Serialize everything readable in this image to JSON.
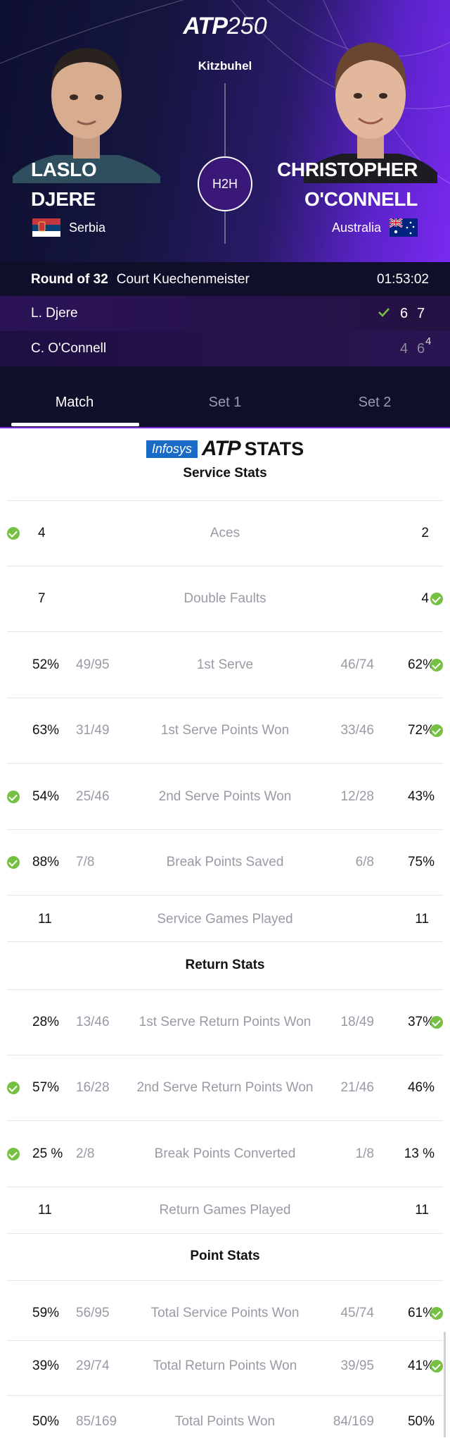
{
  "header": {
    "logo_main": "ATP",
    "logo_num": "250",
    "city": "Kitzbuhel",
    "h2h_label": "H2H",
    "player1": {
      "first": "LASLO",
      "last": "DJERE",
      "country": "Serbia"
    },
    "player2": {
      "first": "CHRISTOPHER",
      "last": "O'CONNELL",
      "country": "Australia"
    }
  },
  "match": {
    "round": "Round of 32",
    "court": "Court Kuechenmeister",
    "duration": "01:53:02",
    "p1_short": "L. Djere",
    "p2_short": "C. O'Connell",
    "p1_set1": "6",
    "p1_set2": "7",
    "p2_set1": "4",
    "p2_set2": "6",
    "p2_tb": "4"
  },
  "tabs": [
    "Match",
    "Set 1",
    "Set 2"
  ],
  "stats_brand": {
    "infosys": "Infosys",
    "atp": "ATP",
    "stats": "STATS"
  },
  "sections": {
    "service": "Service Stats",
    "return": "Return Stats",
    "point": "Point Stats"
  },
  "service_stats": [
    {
      "label": "Aces",
      "left": "4",
      "right": "2",
      "winner": "left"
    },
    {
      "label": "Double Faults",
      "left": "7",
      "right": "4",
      "winner": "right"
    },
    {
      "label": "1st Serve",
      "left": "52%",
      "left_raw": "49/95",
      "right": "62%",
      "right_raw": "46/74",
      "winner": "right"
    },
    {
      "label": "1st Serve Points Won",
      "left": "63%",
      "left_raw": "31/49",
      "right": "72%",
      "right_raw": "33/46",
      "winner": "right"
    },
    {
      "label": "2nd Serve Points Won",
      "left": "54%",
      "left_raw": "25/46",
      "right": "43%",
      "right_raw": "12/28",
      "winner": "left"
    },
    {
      "label": "Break Points Saved",
      "left": "88%",
      "left_raw": "7/8",
      "right": "75%",
      "right_raw": "6/8",
      "winner": "left"
    },
    {
      "label": "Service Games Played",
      "left": "11",
      "right": "11",
      "winner": "none"
    }
  ],
  "return_stats": [
    {
      "label": "1st Serve Return Points Won",
      "left": "28%",
      "left_raw": "13/46",
      "right": "37%",
      "right_raw": "18/49",
      "winner": "right"
    },
    {
      "label": "2nd Serve Return Points Won",
      "left": "57%",
      "left_raw": "16/28",
      "right": "46%",
      "right_raw": "21/46",
      "winner": "left"
    },
    {
      "label": "Break Points Converted",
      "left": "25 %",
      "left_raw": "2/8",
      "right": "13 %",
      "right_raw": "1/8",
      "winner": "left"
    },
    {
      "label": "Return Games Played",
      "left": "11",
      "right": "11",
      "winner": "none"
    }
  ],
  "point_stats": [
    {
      "label": "Total Service Points Won",
      "left": "59%",
      "left_raw": "56/95",
      "right": "61%",
      "right_raw": "45/74",
      "winner": "right"
    },
    {
      "label": "Total Return Points Won",
      "left": "39%",
      "left_raw": "29/74",
      "right": "41%",
      "right_raw": "39/95",
      "winner": "right"
    },
    {
      "label": "Total Points Won",
      "left": "50%",
      "left_raw": "85/169",
      "right": "50%",
      "right_raw": "84/169",
      "winner": "none"
    }
  ],
  "colors": {
    "accent": "#7b2fe0",
    "win_check": "#76c043",
    "bg_dark": "#100f2a"
  }
}
